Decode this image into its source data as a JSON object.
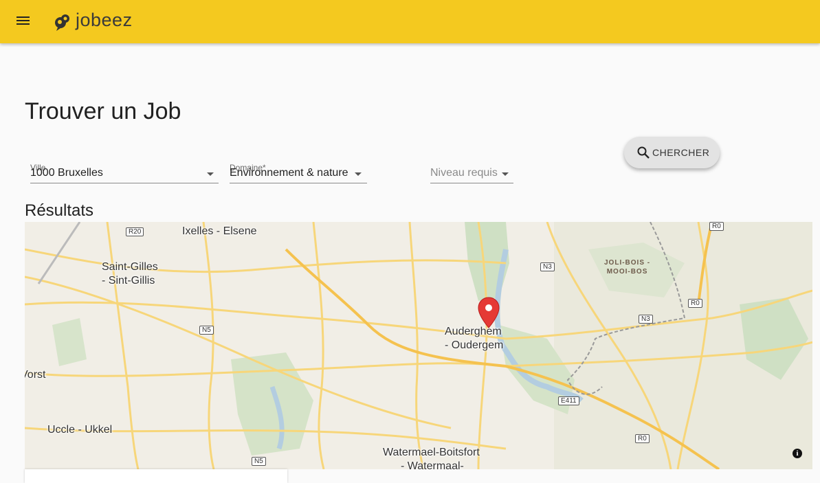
{
  "header": {
    "brand": "jobeez"
  },
  "page": {
    "title": "Trouver un Job",
    "results_title": "Résultats"
  },
  "filters": {
    "ville": {
      "label": "Ville",
      "value": "1000 Bruxelles"
    },
    "domaine": {
      "label": "Domaine*",
      "value": "Environnement & nature"
    },
    "niveau": {
      "placeholder": "Niveau requis"
    },
    "search_button": "CHERCHER"
  },
  "map": {
    "places": {
      "ixelles": "Ixelles - Elsene",
      "saint_gilles_1": "Saint-Gilles",
      "saint_gilles_2": "- Sint-Gillis",
      "auderghem_1": "Auderghem",
      "auderghem_2": "- Oudergem",
      "vorst": "Vorst",
      "uccle": "Uccle - Ukkel",
      "watermael_1": "Watermael-Boitsfort",
      "watermael_2": "- Watermaal-"
    },
    "district_1": "JOLI-BOIS -",
    "district_2": "MOOI-BOS",
    "roads": {
      "r20": "R20",
      "r0_top": "R0",
      "n3_top": "N3",
      "r0_mid": "R0",
      "n3_mid": "N3",
      "n5_top": "N5",
      "e411": "E411",
      "r0_bottom": "R0",
      "n5_bottom": "N5"
    },
    "info_glyph": "i"
  },
  "colors": {
    "appbar": "#f4c91f",
    "marker": "#e53935",
    "road": "#f7d67a"
  }
}
